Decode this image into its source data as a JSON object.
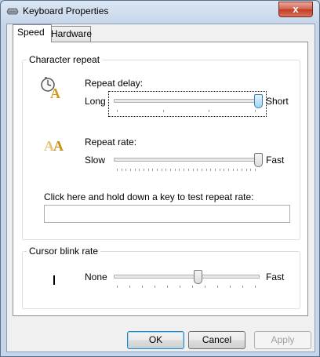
{
  "window": {
    "title": "Keyboard Properties",
    "close_glyph": "x"
  },
  "tabs": [
    {
      "label": "Speed"
    },
    {
      "label": "Hardware"
    }
  ],
  "character_repeat": {
    "title": "Character repeat",
    "repeat_delay": {
      "label": "Repeat delay:",
      "min_label": "Long",
      "max_label": "Short",
      "value": 1.0
    },
    "repeat_rate": {
      "label": "Repeat rate:",
      "min_label": "Slow",
      "max_label": "Fast",
      "value": 1.0
    },
    "test_label": "Click here and hold down a key to test repeat rate:",
    "test_value": ""
  },
  "cursor_blink": {
    "title": "Cursor blink rate",
    "min_label": "None",
    "max_label": "Fast",
    "value": 0.58
  },
  "buttons": {
    "ok": "OK",
    "cancel": "Cancel",
    "apply": "Apply"
  }
}
